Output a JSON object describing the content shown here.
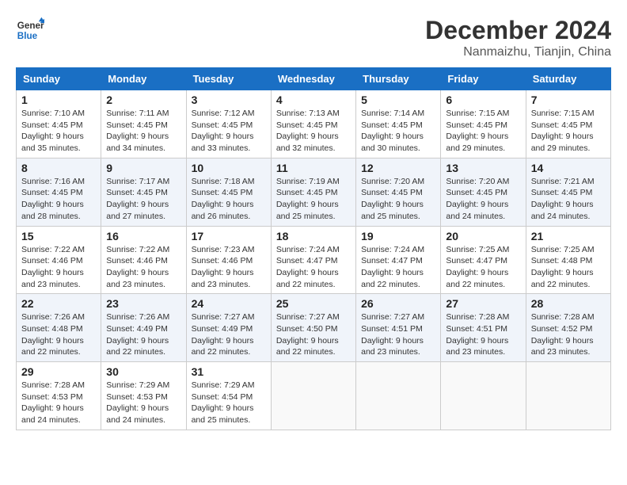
{
  "logo": {
    "line1": "General",
    "line2": "Blue"
  },
  "title": "December 2024",
  "location": "Nanmaizhu, Tianjin, China",
  "weekdays": [
    "Sunday",
    "Monday",
    "Tuesday",
    "Wednesday",
    "Thursday",
    "Friday",
    "Saturday"
  ],
  "weeks": [
    [
      {
        "day": "1",
        "sunrise": "7:10 AM",
        "sunset": "4:45 PM",
        "daylight": "9 hours and 35 minutes."
      },
      {
        "day": "2",
        "sunrise": "7:11 AM",
        "sunset": "4:45 PM",
        "daylight": "9 hours and 34 minutes."
      },
      {
        "day": "3",
        "sunrise": "7:12 AM",
        "sunset": "4:45 PM",
        "daylight": "9 hours and 33 minutes."
      },
      {
        "day": "4",
        "sunrise": "7:13 AM",
        "sunset": "4:45 PM",
        "daylight": "9 hours and 32 minutes."
      },
      {
        "day": "5",
        "sunrise": "7:14 AM",
        "sunset": "4:45 PM",
        "daylight": "9 hours and 30 minutes."
      },
      {
        "day": "6",
        "sunrise": "7:15 AM",
        "sunset": "4:45 PM",
        "daylight": "9 hours and 29 minutes."
      },
      {
        "day": "7",
        "sunrise": "7:15 AM",
        "sunset": "4:45 PM",
        "daylight": "9 hours and 29 minutes."
      }
    ],
    [
      {
        "day": "8",
        "sunrise": "7:16 AM",
        "sunset": "4:45 PM",
        "daylight": "9 hours and 28 minutes."
      },
      {
        "day": "9",
        "sunrise": "7:17 AM",
        "sunset": "4:45 PM",
        "daylight": "9 hours and 27 minutes."
      },
      {
        "day": "10",
        "sunrise": "7:18 AM",
        "sunset": "4:45 PM",
        "daylight": "9 hours and 26 minutes."
      },
      {
        "day": "11",
        "sunrise": "7:19 AM",
        "sunset": "4:45 PM",
        "daylight": "9 hours and 25 minutes."
      },
      {
        "day": "12",
        "sunrise": "7:20 AM",
        "sunset": "4:45 PM",
        "daylight": "9 hours and 25 minutes."
      },
      {
        "day": "13",
        "sunrise": "7:20 AM",
        "sunset": "4:45 PM",
        "daylight": "9 hours and 24 minutes."
      },
      {
        "day": "14",
        "sunrise": "7:21 AM",
        "sunset": "4:45 PM",
        "daylight": "9 hours and 24 minutes."
      }
    ],
    [
      {
        "day": "15",
        "sunrise": "7:22 AM",
        "sunset": "4:46 PM",
        "daylight": "9 hours and 23 minutes."
      },
      {
        "day": "16",
        "sunrise": "7:22 AM",
        "sunset": "4:46 PM",
        "daylight": "9 hours and 23 minutes."
      },
      {
        "day": "17",
        "sunrise": "7:23 AM",
        "sunset": "4:46 PM",
        "daylight": "9 hours and 23 minutes."
      },
      {
        "day": "18",
        "sunrise": "7:24 AM",
        "sunset": "4:47 PM",
        "daylight": "9 hours and 22 minutes."
      },
      {
        "day": "19",
        "sunrise": "7:24 AM",
        "sunset": "4:47 PM",
        "daylight": "9 hours and 22 minutes."
      },
      {
        "day": "20",
        "sunrise": "7:25 AM",
        "sunset": "4:47 PM",
        "daylight": "9 hours and 22 minutes."
      },
      {
        "day": "21",
        "sunrise": "7:25 AM",
        "sunset": "4:48 PM",
        "daylight": "9 hours and 22 minutes."
      }
    ],
    [
      {
        "day": "22",
        "sunrise": "7:26 AM",
        "sunset": "4:48 PM",
        "daylight": "9 hours and 22 minutes."
      },
      {
        "day": "23",
        "sunrise": "7:26 AM",
        "sunset": "4:49 PM",
        "daylight": "9 hours and 22 minutes."
      },
      {
        "day": "24",
        "sunrise": "7:27 AM",
        "sunset": "4:49 PM",
        "daylight": "9 hours and 22 minutes."
      },
      {
        "day": "25",
        "sunrise": "7:27 AM",
        "sunset": "4:50 PM",
        "daylight": "9 hours and 22 minutes."
      },
      {
        "day": "26",
        "sunrise": "7:27 AM",
        "sunset": "4:51 PM",
        "daylight": "9 hours and 23 minutes."
      },
      {
        "day": "27",
        "sunrise": "7:28 AM",
        "sunset": "4:51 PM",
        "daylight": "9 hours and 23 minutes."
      },
      {
        "day": "28",
        "sunrise": "7:28 AM",
        "sunset": "4:52 PM",
        "daylight": "9 hours and 23 minutes."
      }
    ],
    [
      {
        "day": "29",
        "sunrise": "7:28 AM",
        "sunset": "4:53 PM",
        "daylight": "9 hours and 24 minutes."
      },
      {
        "day": "30",
        "sunrise": "7:29 AM",
        "sunset": "4:53 PM",
        "daylight": "9 hours and 24 minutes."
      },
      {
        "day": "31",
        "sunrise": "7:29 AM",
        "sunset": "4:54 PM",
        "daylight": "9 hours and 25 minutes."
      },
      null,
      null,
      null,
      null
    ]
  ]
}
